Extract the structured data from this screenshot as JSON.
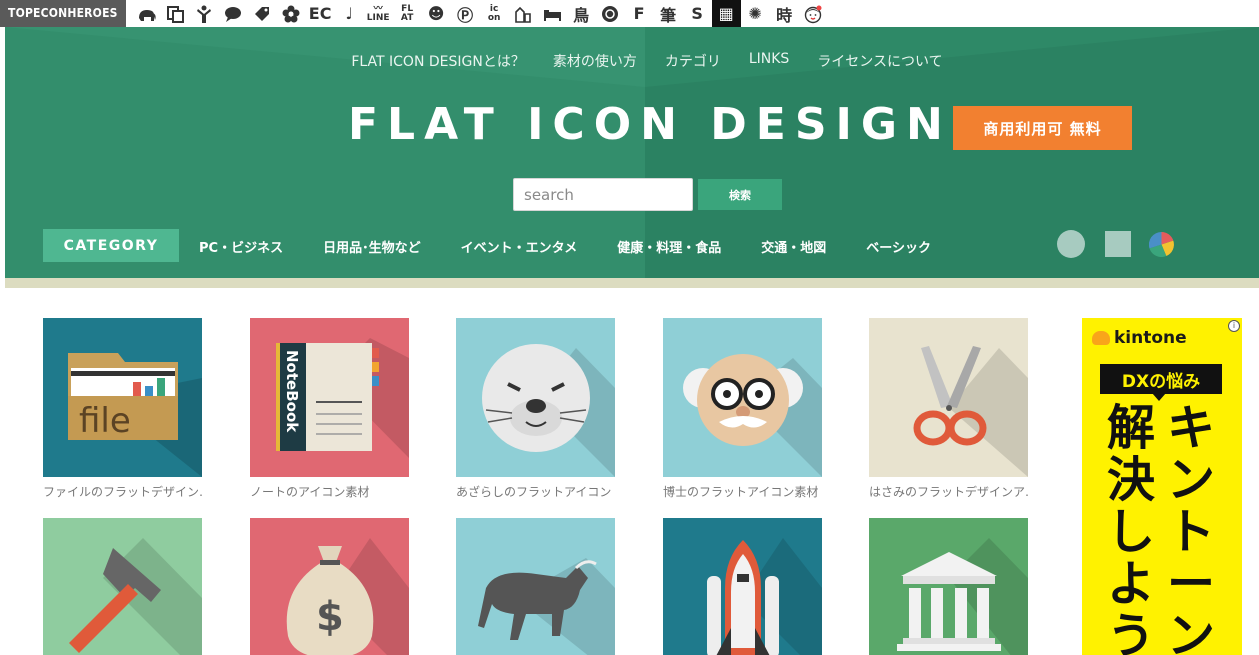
{
  "topbar": {
    "brand": "TOPECONHEROES",
    "sites": [
      {
        "type": "svg",
        "icon": "elephant-icon"
      },
      {
        "type": "svg",
        "icon": "copy-icon"
      },
      {
        "type": "svg",
        "icon": "person-icon"
      },
      {
        "type": "svg",
        "icon": "speech-bubble-icon"
      },
      {
        "type": "svg",
        "icon": "tag-icon"
      },
      {
        "type": "svg",
        "icon": "flower-icon"
      },
      {
        "type": "text",
        "text": "EC"
      },
      {
        "type": "text",
        "text": "♩"
      },
      {
        "type": "small",
        "text": "〰\nLINE"
      },
      {
        "type": "small",
        "text": "FL\nAT"
      },
      {
        "type": "text",
        "text": "☻"
      },
      {
        "type": "text",
        "text": "Ⓟ"
      },
      {
        "type": "small",
        "text": "ic\non"
      },
      {
        "type": "svg",
        "icon": "building-icon"
      },
      {
        "type": "svg",
        "icon": "bed-icon"
      },
      {
        "type": "text",
        "text": "鳥"
      },
      {
        "type": "svg",
        "icon": "badge-icon"
      },
      {
        "type": "text",
        "text": "F"
      },
      {
        "type": "text",
        "text": "筆"
      },
      {
        "type": "text",
        "text": "S"
      },
      {
        "type": "inv",
        "text": "▦"
      },
      {
        "type": "text",
        "text": "✺"
      },
      {
        "type": "text",
        "text": "時"
      },
      {
        "type": "svg",
        "icon": "face-icon"
      }
    ]
  },
  "header": {
    "nav": [
      "FLAT ICON DESIGNとは？",
      "素材の使い方",
      "カテゴリ",
      "LINKS",
      "ライセンスについて"
    ],
    "logo": "FLAT ICON DESIGN",
    "badge": "商用利用可 無料",
    "search": {
      "placeholder": "search",
      "button": "検索"
    },
    "category_label": "CATEGORY",
    "categories": [
      "PC・ビジネス",
      "日用品･生物など",
      "イベント・エンタメ",
      "健康・料理・食品",
      "交通・地図",
      "ベーシック"
    ]
  },
  "icons": [
    {
      "caption": "ファイルのフラットデザインアイコン",
      "art": "file",
      "bg": "#1f7a8c",
      "label": "file"
    },
    {
      "caption": "ノートのアイコン素材",
      "art": "notebook",
      "bg": "#e06872",
      "label": "NoteBook"
    },
    {
      "caption": "あざらしのフラットアイコン",
      "art": "seal",
      "bg": "#8fcfd6"
    },
    {
      "caption": "博士のフラットアイコン素材",
      "art": "doctor",
      "bg": "#8fcfd6"
    },
    {
      "caption": "はさみのフラットデザインアイコン",
      "art": "scissors",
      "bg": "#e8e3cf"
    },
    {
      "caption": "",
      "art": "hammer",
      "bg": "#8fcc9f"
    },
    {
      "caption": "",
      "art": "money",
      "bg": "#e06872",
      "label": "$"
    },
    {
      "caption": "",
      "art": "bull",
      "bg": "#8fcfd6"
    },
    {
      "caption": "",
      "art": "rocket",
      "bg": "#1f7a8c"
    },
    {
      "caption": "",
      "art": "temple",
      "bg": "#5aa86a"
    }
  ],
  "ad": {
    "brand": "kintone",
    "bubble": "DXの悩み",
    "col_left": "解決しよう",
    "col_right": "キントーン",
    "info": "i",
    "colors": {
      "bg": "#fff200",
      "accent": "#f9a51a"
    }
  },
  "colors": {
    "header": "#2f8a68",
    "badge": "#f28030",
    "button": "#3aa57c",
    "category": "#4fb791"
  }
}
